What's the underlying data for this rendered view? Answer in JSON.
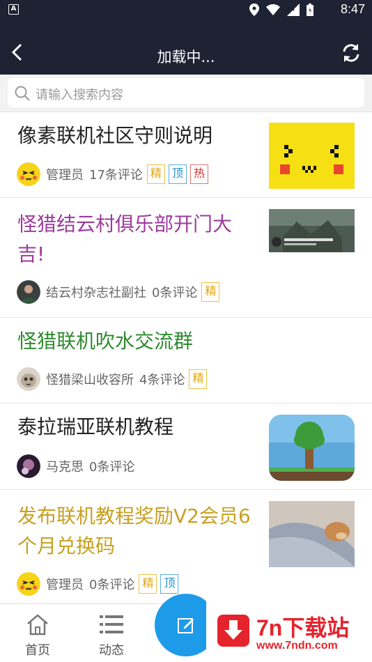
{
  "status_bar": {
    "time": "8:47",
    "app_letter": "A"
  },
  "header": {
    "title": "加载中..."
  },
  "search": {
    "placeholder": "请输入搜索内容"
  },
  "posts": [
    {
      "title": "像素联机社区守则说明",
      "title_color": "#222222",
      "author": "管理员",
      "comments": "17条评论",
      "badges": [
        "精",
        "顶",
        "热"
      ],
      "thumb": "pixel-face"
    },
    {
      "title": "怪猎结云村俱乐部开门大吉!",
      "title_color": "#9c3a9c",
      "author": "结云村杂志社副社",
      "comments": "0条评论",
      "badges": [
        "精"
      ],
      "thumb": "game-screenshot"
    },
    {
      "title": "怪猎联机吹水交流群",
      "title_color": "#2e8b2e",
      "author": "怪猎梁山收容所",
      "comments": "4条评论",
      "badges": [
        "精"
      ],
      "thumb": "none"
    },
    {
      "title": "泰拉瑞亚联机教程",
      "title_color": "#222222",
      "author": "马克思",
      "comments": "0条评论",
      "badges": [],
      "thumb": "terraria-tree"
    },
    {
      "title": "发布联机教程奖励V2会员6个月兑换码",
      "title_color": "#c8a020",
      "author": "管理员",
      "comments": "0条评论",
      "badges": [
        "精",
        "顶"
      ],
      "thumb": "sleeping-dog"
    }
  ],
  "bottom_nav": {
    "home": "首页",
    "feed": "动态"
  },
  "watermark": {
    "name": "7n下载站",
    "url": "www.7ndn.com"
  },
  "colors": {
    "appbar": "#1f2233",
    "accent": "#1e9be8",
    "badge_jing": "#e8a300",
    "badge_ding": "#1a8fd0",
    "badge_re": "#d32f2f"
  }
}
